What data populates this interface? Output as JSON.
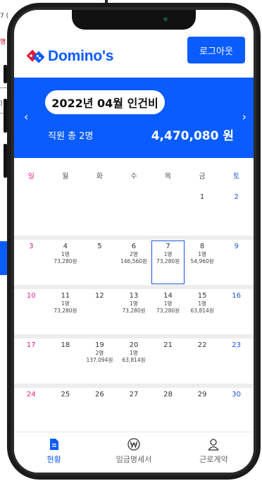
{
  "background": {
    "fragment_1": "7 (",
    "fragment_2": "명",
    "fragment_3": ")"
  },
  "header": {
    "logo_text": "Domino's",
    "logout_label": "로그아웃"
  },
  "summary": {
    "month_title": "2022년 04월 인건비",
    "staff_total": "직원 총 2명",
    "total_amount": "4,470,080 원",
    "prev_icon": "chevron-left-icon",
    "next_icon": "chevron-right-icon"
  },
  "calendar": {
    "weekdays": [
      "일",
      "월",
      "화",
      "수",
      "목",
      "금",
      "토"
    ],
    "weeks": [
      [
        {
          "day": "",
          "staff": "",
          "pay": ""
        },
        {
          "day": "",
          "staff": "",
          "pay": ""
        },
        {
          "day": "",
          "staff": "",
          "pay": ""
        },
        {
          "day": "",
          "staff": "",
          "pay": ""
        },
        {
          "day": "",
          "staff": "",
          "pay": ""
        },
        {
          "day": "1",
          "staff": "",
          "pay": ""
        },
        {
          "day": "2",
          "staff": "",
          "pay": ""
        }
      ],
      [
        {
          "day": "3",
          "staff": "",
          "pay": ""
        },
        {
          "day": "4",
          "staff": "1명",
          "pay": "73,280원"
        },
        {
          "day": "5",
          "staff": "",
          "pay": ""
        },
        {
          "day": "6",
          "staff": "2명",
          "pay": "146,560원"
        },
        {
          "day": "7",
          "staff": "1명",
          "pay": "73,280원",
          "selected": true
        },
        {
          "day": "8",
          "staff": "1명",
          "pay": "54,960원"
        },
        {
          "day": "9",
          "staff": "",
          "pay": ""
        }
      ],
      [
        {
          "day": "10",
          "staff": "",
          "pay": ""
        },
        {
          "day": "11",
          "staff": "1명",
          "pay": "73,280원"
        },
        {
          "day": "12",
          "staff": "",
          "pay": ""
        },
        {
          "day": "13",
          "staff": "1명",
          "pay": "73,280원"
        },
        {
          "day": "14",
          "staff": "1명",
          "pay": "73,280원"
        },
        {
          "day": "15",
          "staff": "1명",
          "pay": "63,814원"
        },
        {
          "day": "16",
          "staff": "",
          "pay": ""
        }
      ],
      [
        {
          "day": "17",
          "staff": "",
          "pay": ""
        },
        {
          "day": "18",
          "staff": "",
          "pay": ""
        },
        {
          "day": "19",
          "staff": "2명",
          "pay": "137,094원"
        },
        {
          "day": "20",
          "staff": "1명",
          "pay": "63,814원"
        },
        {
          "day": "21",
          "staff": "",
          "pay": ""
        },
        {
          "day": "22",
          "staff": "",
          "pay": ""
        },
        {
          "day": "23",
          "staff": "",
          "pay": ""
        }
      ],
      [
        {
          "day": "24",
          "staff": "",
          "pay": ""
        },
        {
          "day": "25",
          "staff": "",
          "pay": ""
        },
        {
          "day": "26",
          "staff": "",
          "pay": ""
        },
        {
          "day": "27",
          "staff": "",
          "pay": ""
        },
        {
          "day": "28",
          "staff": "",
          "pay": ""
        },
        {
          "day": "29",
          "staff": "",
          "pay": ""
        },
        {
          "day": "30",
          "staff": "",
          "pay": ""
        }
      ]
    ]
  },
  "tabbar": {
    "tabs": [
      {
        "label": "현황",
        "icon": "document-icon",
        "active": true
      },
      {
        "label": "임금명세서",
        "icon": "won-icon",
        "active": false
      },
      {
        "label": "근로계약",
        "icon": "person-icon",
        "active": false
      }
    ]
  },
  "colors": {
    "brand_blue": "#0a5cff",
    "sunday": "#e0208a",
    "saturday": "#1a56db"
  }
}
